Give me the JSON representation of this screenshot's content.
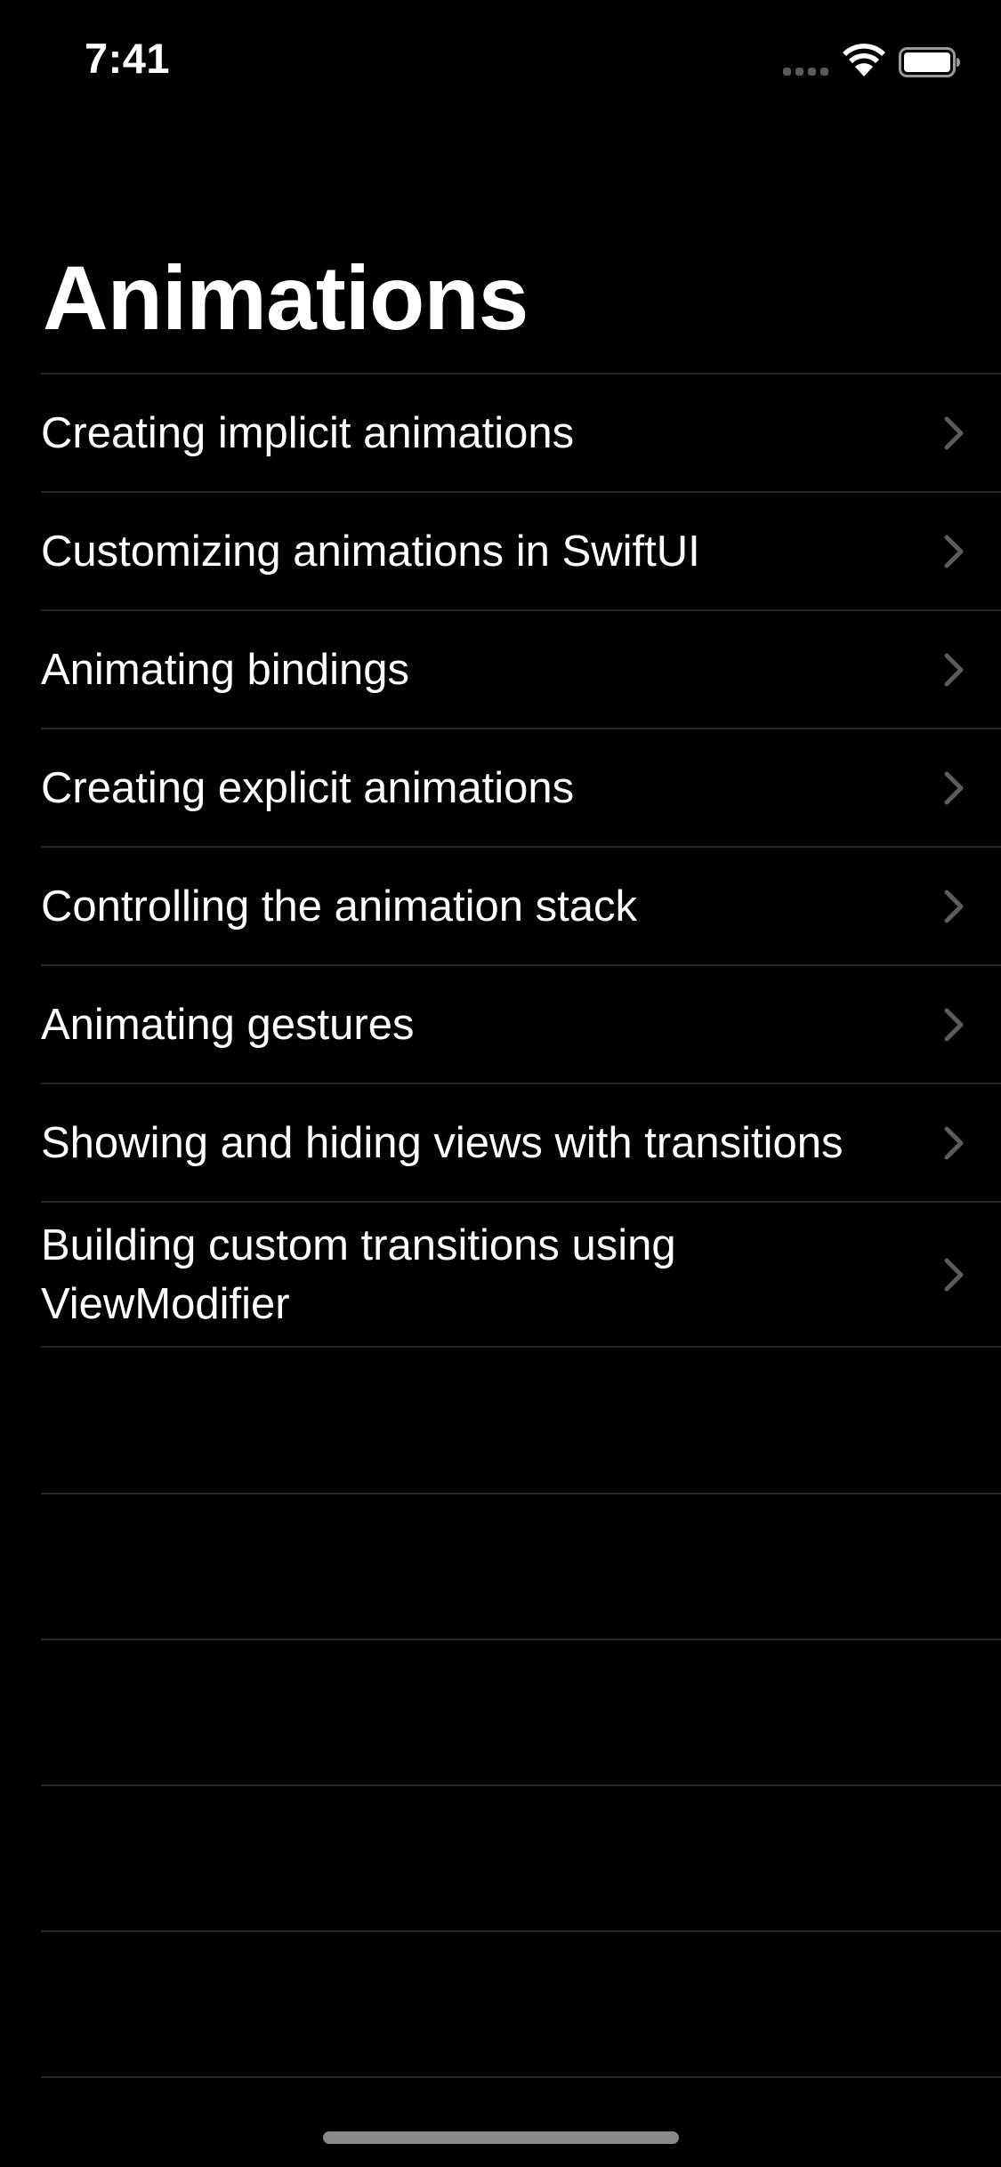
{
  "status_bar": {
    "time": "7:41"
  },
  "nav": {
    "title": "Animations"
  },
  "list": {
    "items": [
      {
        "label": "Creating implicit animations"
      },
      {
        "label": "Customizing animations in SwiftUI"
      },
      {
        "label": "Animating bindings"
      },
      {
        "label": "Creating explicit animations"
      },
      {
        "label": "Controlling the animation stack"
      },
      {
        "label": "Animating gestures"
      },
      {
        "label": "Showing and hiding views with transitions"
      },
      {
        "label": "Building custom transitions using ViewModifier"
      }
    ]
  },
  "icons": {
    "row_disclosure": "chevron-right-icon",
    "signal": "cellular-signal-icon",
    "wifi": "wifi-icon",
    "battery": "battery-icon"
  },
  "colors": {
    "background": "#000000",
    "text": "#ffffff",
    "separator": "#262628",
    "chevron": "#5c5c60"
  }
}
